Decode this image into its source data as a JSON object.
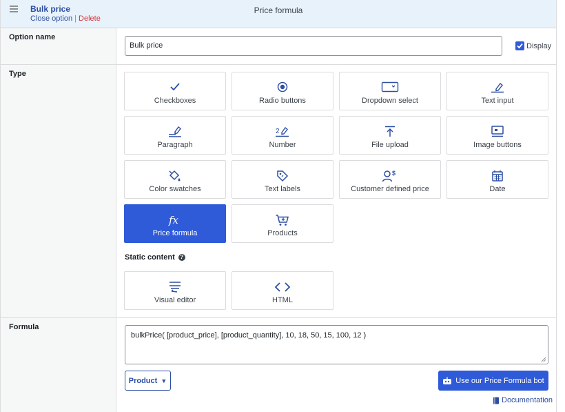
{
  "header": {
    "title": "Bulk price",
    "close_label": "Close option",
    "separator": "|",
    "delete_label": "Delete",
    "option_type": "Price formula"
  },
  "option_name": {
    "label": "Option name",
    "value": "Bulk price",
    "display_label": "Display",
    "display_checked": true
  },
  "type": {
    "label": "Type",
    "tiles": [
      {
        "label": "Checkboxes",
        "icon": "check-icon"
      },
      {
        "label": "Radio buttons",
        "icon": "radio-icon"
      },
      {
        "label": "Dropdown select",
        "icon": "dropdown-icon"
      },
      {
        "label": "Text input",
        "icon": "pencil-icon"
      },
      {
        "label": "Paragraph",
        "icon": "paragraph-icon"
      },
      {
        "label": "Number",
        "icon": "number-icon"
      },
      {
        "label": "File upload",
        "icon": "upload-icon"
      },
      {
        "label": "Image buttons",
        "icon": "image-icon"
      },
      {
        "label": "Color swatches",
        "icon": "paint-bucket-icon"
      },
      {
        "label": "Text labels",
        "icon": "tag-icon"
      },
      {
        "label": "Customer defined price",
        "icon": "user-dollar-icon"
      },
      {
        "label": "Date",
        "icon": "calendar-icon"
      },
      {
        "label": "Price formula",
        "icon": "fx-icon",
        "active": true
      },
      {
        "label": "Products",
        "icon": "cart-icon"
      }
    ],
    "static_title": "Static content",
    "static_tiles": [
      {
        "label": "Visual editor",
        "icon": "text-format-icon"
      },
      {
        "label": "HTML",
        "icon": "code-icon"
      }
    ],
    "fx_glyph": "fx",
    "number_glyph": "2"
  },
  "formula": {
    "label": "Formula",
    "value": "bulkPrice( [product_price], [product_quantity], 10, 18, 50, 15, 100, 12 )",
    "product_button": "Product",
    "bot_button": "Use our Price Formula bot",
    "doc_link": "Documentation"
  },
  "colors": {
    "accent": "#2f5bd8",
    "link": "#2c4ea3",
    "danger": "#d63638",
    "header_bg": "#e8f2fb"
  }
}
